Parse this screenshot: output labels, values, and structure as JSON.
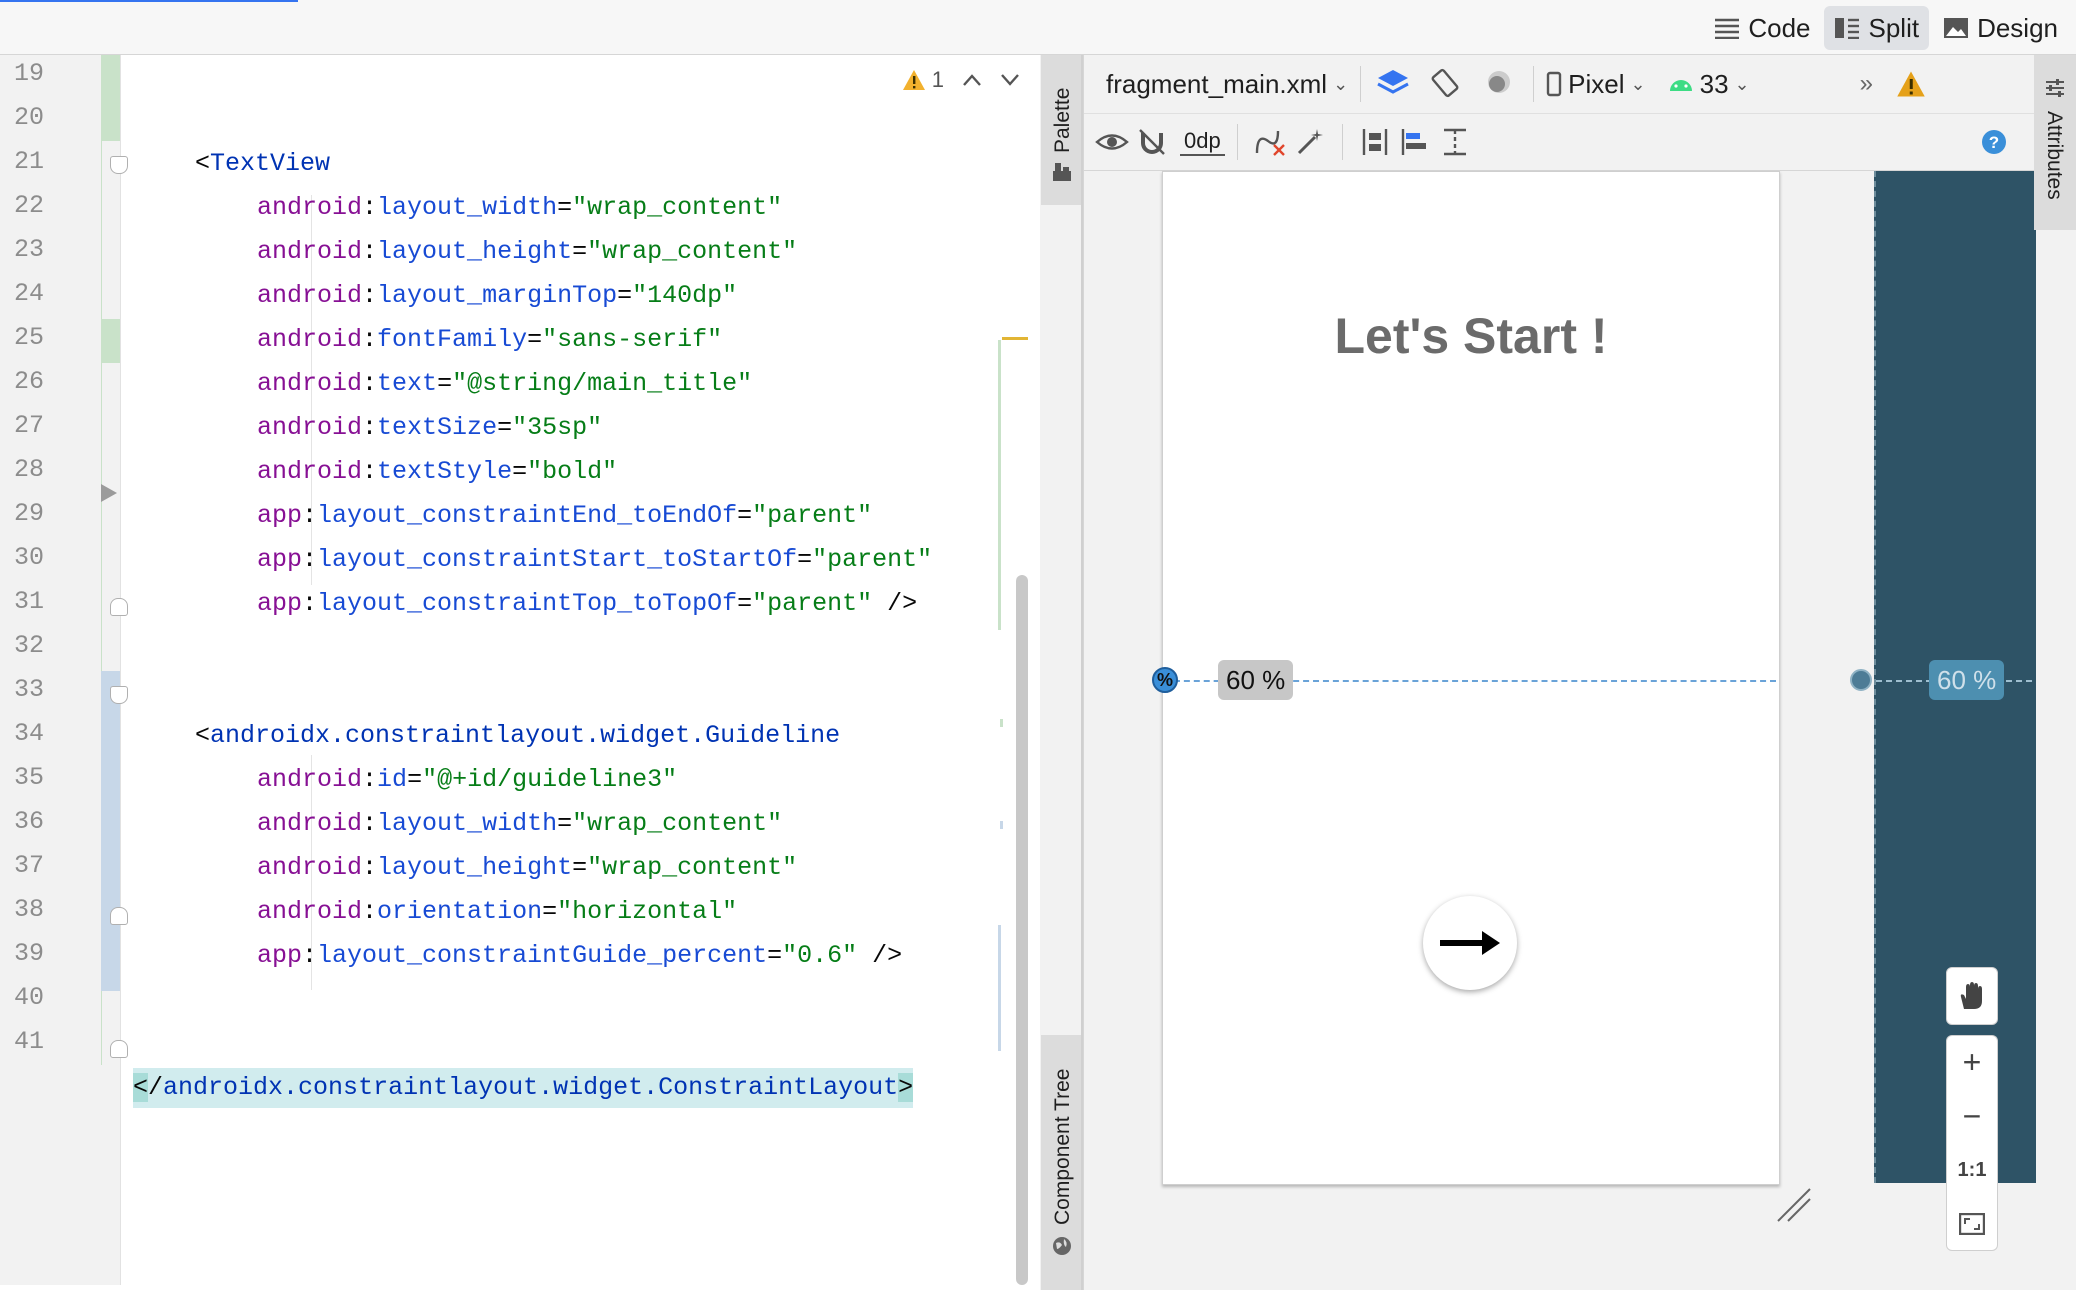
{
  "view_modes": {
    "code": "Code",
    "split": "Split",
    "design": "Design",
    "active": "Split"
  },
  "editor": {
    "inspection_count": "1",
    "lines": [
      {
        "n": "19"
      },
      {
        "n": "20"
      },
      {
        "n": "21"
      },
      {
        "n": "22"
      },
      {
        "n": "23"
      },
      {
        "n": "24"
      },
      {
        "n": "25"
      },
      {
        "n": "26"
      },
      {
        "n": "27"
      },
      {
        "n": "28"
      },
      {
        "n": "29"
      },
      {
        "n": "30"
      },
      {
        "n": "31"
      },
      {
        "n": "32"
      },
      {
        "n": "33"
      },
      {
        "n": "34"
      },
      {
        "n": "35"
      },
      {
        "n": "36"
      },
      {
        "n": "37"
      },
      {
        "n": "38"
      },
      {
        "n": "39"
      },
      {
        "n": "40"
      },
      {
        "n": "41"
      }
    ],
    "code": {
      "l21_tag": "TextView",
      "l22_ns": "android",
      "l22_attr": "layout_width",
      "l22_val": "\"wrap_content\"",
      "l23_ns": "android",
      "l23_attr": "layout_height",
      "l23_val": "\"wrap_content\"",
      "l24_ns": "android",
      "l24_attr": "layout_marginTop",
      "l24_val": "\"140dp\"",
      "l25_ns": "android",
      "l25_attr": "fontFamily",
      "l25_val": "\"sans-serif\"",
      "l26_ns": "android",
      "l26_attr": "text",
      "l26_val": "\"@string/main_title\"",
      "l27_ns": "android",
      "l27_attr": "textSize",
      "l27_val": "\"35sp\"",
      "l28_ns": "android",
      "l28_attr": "textStyle",
      "l28_val": "\"bold\"",
      "l29_ns": "app",
      "l29_attr": "layout_constraintEnd_toEndOf",
      "l29_val": "\"parent\"",
      "l30_ns": "app",
      "l30_attr": "layout_constraintStart_toStartOf",
      "l30_val": "\"parent\"",
      "l31_ns": "app",
      "l31_attr": "layout_constraintTop_toTopOf",
      "l31_val": "\"parent\"",
      "l31_end": " />",
      "l33_tag": "androidx.constraintlayout.widget.Guideline",
      "l34_ns": "android",
      "l34_attr": "id",
      "l34_val": "\"@+id/guideline3\"",
      "l35_ns": "android",
      "l35_attr": "layout_width",
      "l35_val": "\"wrap_content\"",
      "l36_ns": "android",
      "l36_attr": "layout_height",
      "l36_val": "\"wrap_content\"",
      "l37_ns": "android",
      "l37_attr": "orientation",
      "l37_val": "\"horizontal\"",
      "l38_ns": "app",
      "l38_attr": "layout_constraintGuide_percent",
      "l38_val": "\"0.6\"",
      "l38_end": " />",
      "l41_tag": "androidx.constraintlayout.widget.ConstraintLayout"
    }
  },
  "side_tabs": {
    "palette": "Palette",
    "component_tree": "Component Tree",
    "attributes": "Attributes"
  },
  "design_toolbar": {
    "file": "fragment_main.xml",
    "device": "Pixel",
    "api": "33",
    "margin": "0dp",
    "more": "»"
  },
  "preview": {
    "title_text": "Let's Start !",
    "guideline_label": "60 %",
    "guideline_percent_badge": "%",
    "guideline_percent": 0.6
  },
  "zoom_controls": {
    "zoom_in": "+",
    "zoom_out": "−",
    "actual_size": "1:1"
  },
  "colors": {
    "accent": "#3574f0",
    "blueprint": "#2e5366",
    "tag": "#0033b3",
    "attr": "#174ad4",
    "value": "#067d17",
    "namespace": "#871094"
  }
}
